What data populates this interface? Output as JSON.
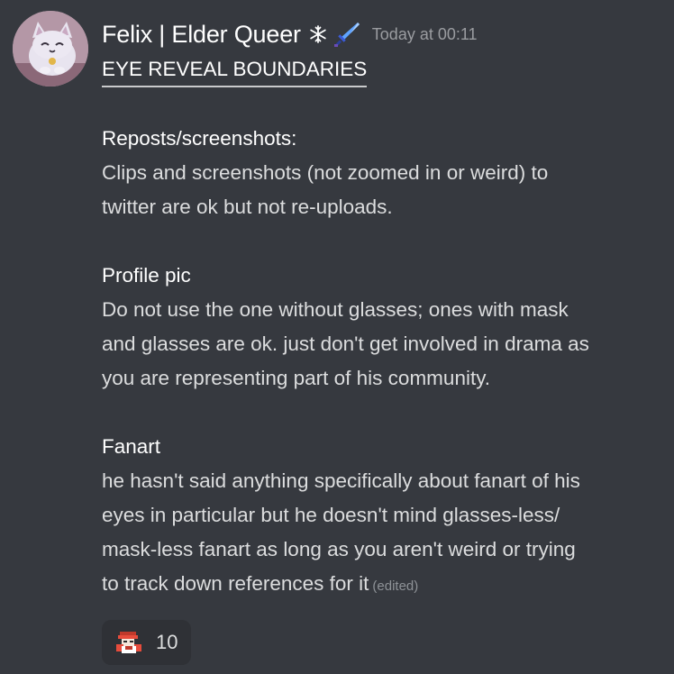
{
  "message": {
    "avatar_icon": "cat-avatar-icon",
    "username": "Felix | Elder Queer",
    "badges": [
      "snowflake-icon",
      "sword-icon"
    ],
    "timestamp": "Today at 00:11",
    "title": "EYE REVEAL BOUNDARIES",
    "sections": [
      {
        "heading": "Reposts/screenshots:",
        "lines": [
          "Clips and screenshots (not zoomed in or weird)  to",
          "twitter are ok but not re-uploads."
        ]
      },
      {
        "heading": "Profile pic",
        "lines": [
          "Do not use the one without glasses; ones with mask",
          "and glasses are ok. just don't get involved in drama as",
          "you are representing part of his community."
        ]
      },
      {
        "heading": "Fanart",
        "lines": [
          "he hasn't said anything specifically about fanart of his",
          "eyes in particular but he doesn't mind glasses-less/",
          "mask-less fanart as long as you aren't weird or trying",
          "to track down references for it"
        ]
      }
    ],
    "edited_label": "(edited)",
    "reaction": {
      "emoji": "custom-character-emoji-icon",
      "count": "10"
    }
  },
  "colors": {
    "background": "#36393f",
    "username": "#ffffff",
    "text": "#dcddde",
    "timestamp": "#9a9ca0",
    "reaction_bg": "#2f3136"
  }
}
